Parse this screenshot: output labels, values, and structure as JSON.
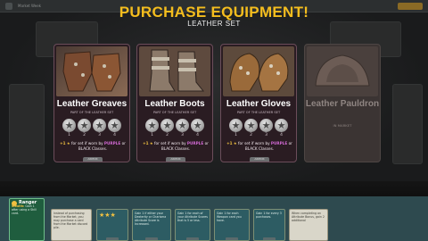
{
  "top_bar": {
    "left_tag": "Market Week",
    "right_tag": "End Turn"
  },
  "modal": {
    "title": "LEATHER SET"
  },
  "cards": [
    {
      "name": "Leather Greaves",
      "subtitle": "PART OF THE LEATHER SET",
      "levels": [
        "1",
        "2",
        "3",
        "4"
      ],
      "bonus_prefix": "+1",
      "bonus_mid": "for set if worn by",
      "bonus_purple": "PURPLE",
      "bonus_or": "or",
      "bonus_end": "BLACK Classes.",
      "badge": "ARMOR",
      "star_glyph": "★"
    },
    {
      "name": "Leather Boots",
      "subtitle": "PART OF THE LEATHER SET",
      "levels": [
        "1",
        "2",
        "3",
        "4"
      ],
      "bonus_prefix": "+1",
      "bonus_mid": "for set if worn by",
      "bonus_purple": "PURPLE",
      "bonus_or": "or",
      "bonus_end": "BLACK Classes.",
      "badge": "ARMOR",
      "star_glyph": "★"
    },
    {
      "name": "Leather Gloves",
      "subtitle": "PART OF THE LEATHER SET",
      "levels": [
        "1",
        "2",
        "3",
        "4"
      ],
      "bonus_prefix": "+1",
      "bonus_mid": "for set if worn by",
      "bonus_purple": "PURPLE",
      "bonus_or": "or",
      "bonus_end": "BLACK Classes.",
      "badge": "ARMOR",
      "star_glyph": "★"
    },
    {
      "name": "Leather Pauldron",
      "status": "IN MARKET"
    }
  ],
  "banner": {
    "text": "PURCHASE EQUIPMENT!"
  },
  "hand": {
    "ranger": {
      "name": "Ranger",
      "label": "Stealth:",
      "text_a": "Gain 1",
      "text_b": "after using a Skill card."
    },
    "mini_cards": [
      {
        "text": "Instead of purchasing from the Market, you may purchase a card from the Market discard pile."
      },
      {
        "stars": "★★★"
      },
      {
        "text": "Gain 1 if either your Dexterity or Charisma Attribute Score is Increased."
      },
      {
        "text": "Gain 1 for each of your Attribute Scores that is 5 or less."
      },
      {
        "text": "Gain 1 for each Weapon card you have."
      },
      {
        "text": "Gain 1 for every 3 purchases."
      },
      {
        "text": "When completing an Attribute Bonus, gain 2 additional"
      }
    ]
  },
  "colors": {
    "banner_gold": "#f4bd1e",
    "purple": "#d46ad6",
    "gold": "#f0c040",
    "card_bg": "#2a1c22"
  }
}
